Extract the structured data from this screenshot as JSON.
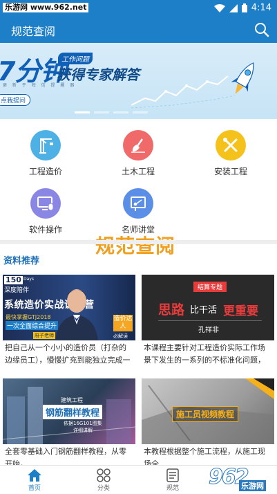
{
  "status_bar": {
    "watermark": "乐游网 www.962.net",
    "time": "4:14"
  },
  "header": {
    "title": "规范查阅",
    "search_icon": "search-icon"
  },
  "banner": {
    "headline": "7分钟",
    "tag": "工作问题",
    "subline": "获得专家解答",
    "tiny_text": "更 新 于 短 信 提 醒 器",
    "button": "点我提问",
    "page_index": 1,
    "page_count": 4,
    "colors": {
      "primary": "#1060b8",
      "background": "#cfe8f7"
    }
  },
  "categories": [
    {
      "label": "工程造价",
      "icon": "crane-icon",
      "color": "#4db1e6"
    },
    {
      "label": "土木工程",
      "icon": "shovel-icon",
      "color": "#f06a6a"
    },
    {
      "label": "安装工程",
      "icon": "tools-icon",
      "color": "#f5c21c"
    },
    {
      "label": "软件操作",
      "icon": "computer-mouse-icon",
      "color": "#8a86e4"
    },
    {
      "label": "名师讲堂",
      "icon": "presentation-icon",
      "color": "#5b8ee6"
    }
  ],
  "watermark_overlay": "规范查阅",
  "section": {
    "title": "资料推荐"
  },
  "cards": [
    {
      "desc": "把自己从一个小小的造价员（打杂的边缘员工），慢慢扩充到能独立完成一个项...",
      "img": {
        "badge_num": "150",
        "badge_unit": "Days",
        "badge_text": "深度陪伴",
        "title": "系统造价实战训练营",
        "line1": "最快掌握GTJ2018",
        "line2": "一次全面综合提升",
        "tag": "造价达人",
        "tag2": "必解读",
        "name": "府子老师"
      }
    },
    {
      "desc": "本课程主要针对工程造价实际工作场景下发生的一系列的不标准化问题，如何应...",
      "img": {
        "tag": "结算专题",
        "word1": "思路",
        "word2": "比干活",
        "word3": "更重要",
        "name": "孔祥非"
      }
    },
    {
      "desc": "全套零基础入门钢筋翻样教程，从零开始，……",
      "img": {
        "tag": "建筑工程",
        "title": "钢筋翻样教程",
        "line1": "依据16G101图集",
        "line2": "详细讲解"
      }
    },
    {
      "desc": "本教程根据整个施工流程，从施工现场全",
      "img": {
        "title": "施工员视频教程"
      }
    }
  ],
  "tabbar": {
    "tabs": [
      {
        "label": "首页",
        "icon": "home-icon"
      },
      {
        "label": "分类",
        "icon": "grid-icon"
      },
      {
        "label": "规范",
        "icon": "document-icon"
      }
    ],
    "active_color": "#1e7fc9"
  },
  "corner_logo": {
    "number": "962",
    "text": "乐游网"
  }
}
